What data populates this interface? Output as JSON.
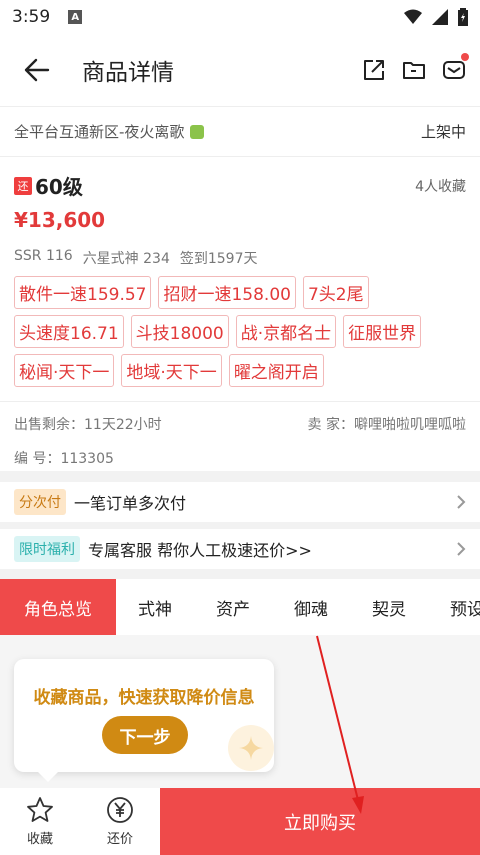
{
  "status_bar": {
    "time": "3:59",
    "badge": "A"
  },
  "nav": {
    "title": "商品详情"
  },
  "server": {
    "name": "全平台互通新区-夜火离歌",
    "state": "上架中"
  },
  "item": {
    "badge": "还",
    "level": "60级",
    "favorites": "4人收藏",
    "price": "¥13,600",
    "stats": [
      "SSR 116",
      "六星式神 234",
      "签到1597天"
    ],
    "tags": [
      "散件一速159.57",
      "招财一速158.00",
      "7头2尾",
      "头速度16.71",
      "斗技18000",
      "战·京都名士",
      "征服世界",
      "秘闻·天下一",
      "地域·天下一",
      "曜之阁开启"
    ],
    "sale_remaining": "出售剩余：11天22小时",
    "seller": "卖  家：噼哩啪啦叽哩呱啦",
    "id": "编  号：113305"
  },
  "promos": [
    {
      "chip": "分次付",
      "text": "一笔订单多次付",
      "chip_bg": "#fde6c8",
      "chip_color": "#c87a14"
    },
    {
      "chip": "限时福利",
      "text": "专属客服 帮你人工极速还价>>",
      "chip_bg": "#d9f4f4",
      "chip_color": "#2bb0ac"
    }
  ],
  "tabs": [
    "角色总览",
    "式神",
    "资产",
    "御魂",
    "契灵",
    "预设"
  ],
  "tooltip": {
    "message": "收藏商品，快速获取降价信息",
    "next_label": "下一步"
  },
  "bottom_bar": {
    "favorite_label": "收藏",
    "bargain_label": "还价",
    "buy_label": "立即购买"
  },
  "colors": {
    "accent": "#ef4a4a",
    "price": "#e23a3a",
    "tooltip": "#d08a13"
  }
}
